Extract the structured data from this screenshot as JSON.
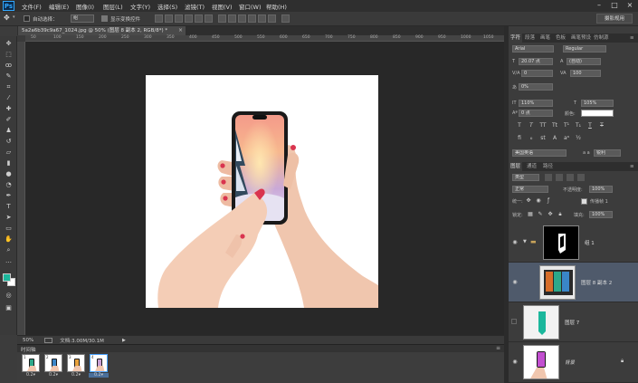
{
  "app": {
    "logo": "Ps"
  },
  "menu": [
    "文件(F)",
    "编辑(E)",
    "图像(I)",
    "图层(L)",
    "文字(Y)",
    "选择(S)",
    "滤镜(T)",
    "视图(V)",
    "窗口(W)",
    "帮助(H)"
  ],
  "window_controls": {
    "minimize": "–",
    "maximize": "□",
    "close": "×"
  },
  "options": {
    "auto_select_label": "自动选择：",
    "auto_select_value": "组",
    "show_transform_label": "显示变换控件",
    "workspace": "摄影规用"
  },
  "document": {
    "tab_title": "5a2a6b39c9a67_1024.jpg @ 50% (图层 8 副本 2, RGB/8*) *",
    "close": "×"
  },
  "ruler": [
    "50",
    "100",
    "150",
    "200",
    "250",
    "300",
    "350",
    "400",
    "450",
    "500",
    "550",
    "600",
    "650",
    "700",
    "750",
    "800",
    "850",
    "900",
    "950",
    "1000",
    "1050"
  ],
  "status": {
    "zoom": "50%",
    "doc": "文档:3.00M/30.1M"
  },
  "timeline": {
    "title": "时间轴",
    "frames": [
      {
        "num": "1",
        "dur": "0.2"
      },
      {
        "num": "2",
        "dur": "0.2"
      },
      {
        "num": "3",
        "dur": "0.2"
      },
      {
        "num": "4",
        "dur": "0.2",
        "selected": true
      }
    ]
  },
  "char_panel": {
    "tabs": [
      "字符",
      "段落",
      "画笔",
      "色板",
      "画笔预设",
      "仿制源"
    ],
    "font": "Arial",
    "style": "Regular",
    "size": "20.07 点",
    "leading": "(自动)",
    "kerning": "0",
    "tracking": "100",
    "scale_pct": "0%",
    "vscale": "110%",
    "hscale": "105%",
    "baseline": "0 点",
    "color_label": "颜色:",
    "color": "#ffffff",
    "language": "美国英语",
    "aa": "锐利",
    "aa_label": "a a"
  },
  "layers_panel": {
    "tabs": [
      "图层",
      "通道",
      "路径"
    ],
    "kind": "类型",
    "blend": "正常",
    "opacity_label": "不透明度:",
    "opacity": "100%",
    "unify_label": "统一:",
    "propagate_label": "传播帧 1",
    "lock_label": "锁定:",
    "fill_label": "填充:",
    "fill": "100%",
    "layers": [
      {
        "name": "组 1",
        "type": "group"
      },
      {
        "name": "图层 8 副本 2",
        "type": "layer",
        "selected": true
      },
      {
        "name": "图层 7",
        "type": "layer"
      },
      {
        "name": "背景",
        "type": "background"
      }
    ]
  },
  "colors": {
    "accent": "#31a8ff",
    "fg_swatch": "#1bb79c",
    "bg_swatch": "#ffffff"
  }
}
